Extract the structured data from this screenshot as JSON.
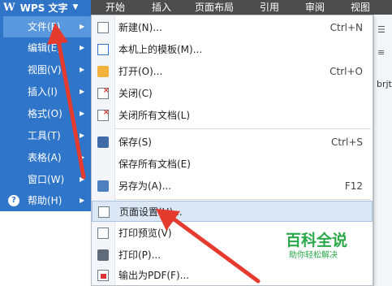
{
  "app": {
    "name": "WPS 文字",
    "logo": "W"
  },
  "ribbon": {
    "tabs": [
      "开始",
      "插入",
      "页面布局",
      "引用",
      "审阅",
      "视图"
    ]
  },
  "left_menu": {
    "items": [
      {
        "label": "文件(F)"
      },
      {
        "label": "编辑(E)"
      },
      {
        "label": "视图(V)"
      },
      {
        "label": "插入(I)"
      },
      {
        "label": "格式(O)"
      },
      {
        "label": "工具(T)"
      },
      {
        "label": "表格(A)"
      },
      {
        "label": "窗口(W)"
      },
      {
        "label": "帮助(H)"
      }
    ],
    "active_index": 0
  },
  "file_menu": {
    "items": [
      {
        "label": "新建(N)...",
        "shortcut": "Ctrl+N",
        "icon": "new-doc-icon"
      },
      {
        "label": "本机上的模板(M)...",
        "shortcut": "",
        "icon": "template-icon"
      },
      {
        "label": "打开(O)...",
        "shortcut": "Ctrl+O",
        "icon": "folder-icon"
      },
      {
        "label": "关闭(C)",
        "shortcut": "",
        "icon": "close-doc-icon"
      },
      {
        "label": "关闭所有文档(L)",
        "shortcut": "",
        "icon": "close-all-icon"
      },
      {
        "label": "保存(S)",
        "shortcut": "Ctrl+S",
        "icon": "save-icon"
      },
      {
        "label": "保存所有文档(E)",
        "shortcut": "",
        "icon": ""
      },
      {
        "label": "另存为(A)...",
        "shortcut": "F12",
        "icon": "save-as-icon"
      },
      {
        "label": "页面设置(U)...",
        "shortcut": "",
        "icon": "page-setup-icon"
      },
      {
        "label": "打印预览(V)",
        "shortcut": "",
        "icon": "print-preview-icon"
      },
      {
        "label": "打印(P)...",
        "shortcut": "",
        "icon": "printer-icon"
      },
      {
        "label": "输出为PDF(F)...",
        "shortcut": "",
        "icon": "pdf-icon"
      }
    ],
    "highlighted_index": 8
  },
  "doc_text": "brjt",
  "watermark": {
    "title": "百科全说",
    "subtitle": "助你轻松解决"
  },
  "colors": {
    "menu_blue": "#2f75c9",
    "annotation_red": "#e53a2e",
    "highlight": "#dce7f6"
  }
}
